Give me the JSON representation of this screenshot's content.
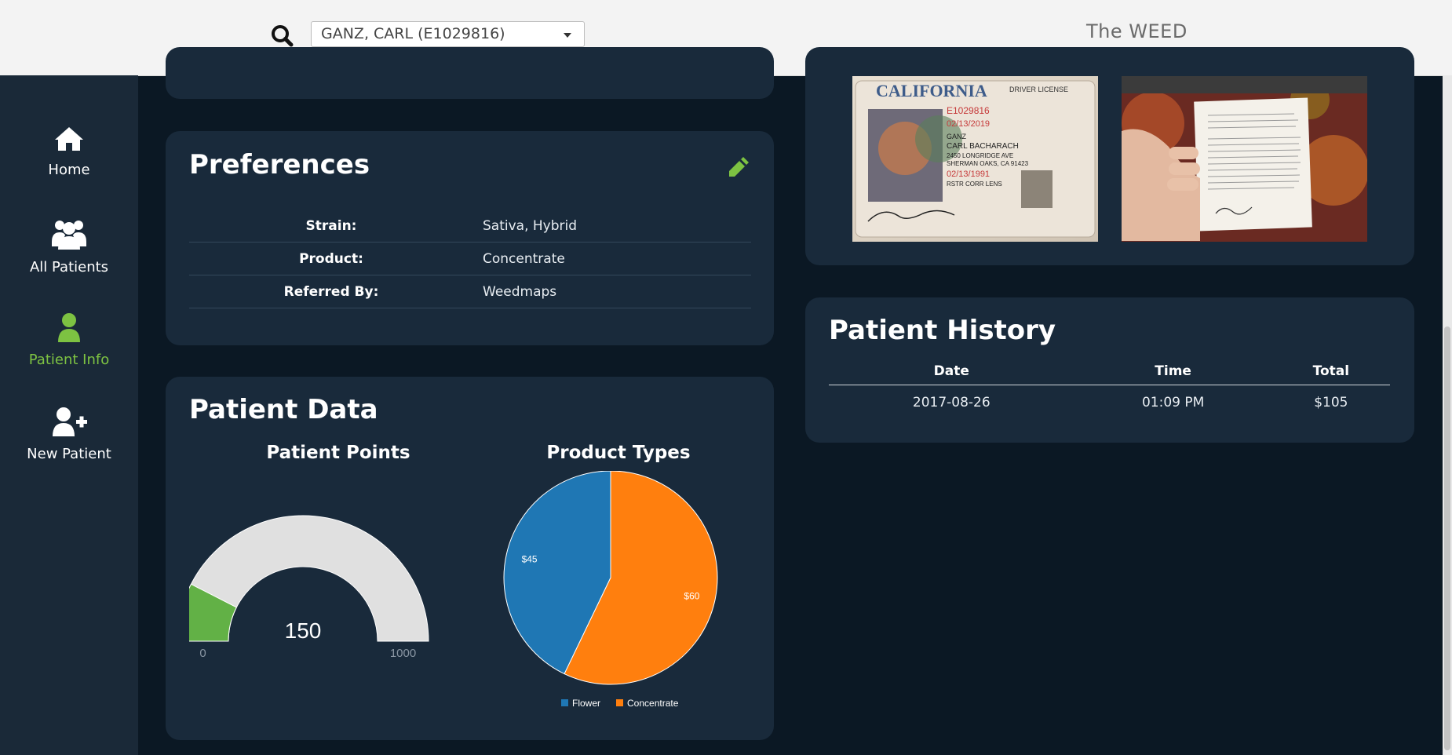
{
  "header": {
    "search_icon": "search-icon",
    "patient_select": {
      "value": "GANZ, CARL (E1029816)"
    },
    "brand": "The WEED"
  },
  "sidebar": {
    "items": [
      {
        "label": "Home",
        "icon": "home-icon",
        "active": false
      },
      {
        "label": "All Patients",
        "icon": "users-icon",
        "active": false
      },
      {
        "label": "Patient Info",
        "icon": "user-icon",
        "active": true
      },
      {
        "label": "New Patient",
        "icon": "user-plus-icon",
        "active": false
      }
    ]
  },
  "preferences": {
    "title": "Preferences",
    "edit_icon": "pencil-icon",
    "rows": [
      {
        "key": "Strain:",
        "value": "Sativa, Hybrid"
      },
      {
        "key": "Product:",
        "value": "Concentrate"
      },
      {
        "key": "Referred By:",
        "value": "Weedmaps"
      }
    ]
  },
  "patient_data": {
    "title": "Patient Data",
    "points_title": "Patient Points",
    "types_title": "Product Types"
  },
  "id_images": {
    "license": {
      "state": "CALIFORNIA",
      "doc_type": "DRIVER LICENSE",
      "number": "E1029816",
      "exp": "02/13/2019",
      "last_name": "GANZ",
      "first_name": "CARL BACHARACH",
      "address1": "2450 LONGRIDGE AVE",
      "address2": "SHERMAN OAKS, CA 91423",
      "dob": "02/13/1991",
      "restriction": "RSTR CORR LENS"
    }
  },
  "history": {
    "title": "Patient History",
    "columns": [
      "Date",
      "Time",
      "Total"
    ],
    "rows": [
      {
        "date": "2017-08-26",
        "time": "01:09 PM",
        "total": "$105"
      }
    ]
  },
  "chart_data": [
    {
      "type": "gauge",
      "title": "Patient Points",
      "value": 150,
      "min": 0,
      "max": 1000,
      "value_label": "150",
      "min_label": "0",
      "max_label": "1000",
      "colors": {
        "fill": "#62b146",
        "track": "#e0e0e0"
      }
    },
    {
      "type": "pie",
      "title": "Product Types",
      "labels": [
        "Flower",
        "Concentrate"
      ],
      "values": [
        45,
        60
      ],
      "data_labels": [
        "$45",
        "$60"
      ],
      "colors": [
        "#1f77b4",
        "#ff7f0e"
      ],
      "legend": "bottom"
    }
  ],
  "colors": {
    "accent": "#7dc242",
    "card": "#192a3b",
    "page": "#0b1824",
    "sidebar": "#1a2938"
  }
}
